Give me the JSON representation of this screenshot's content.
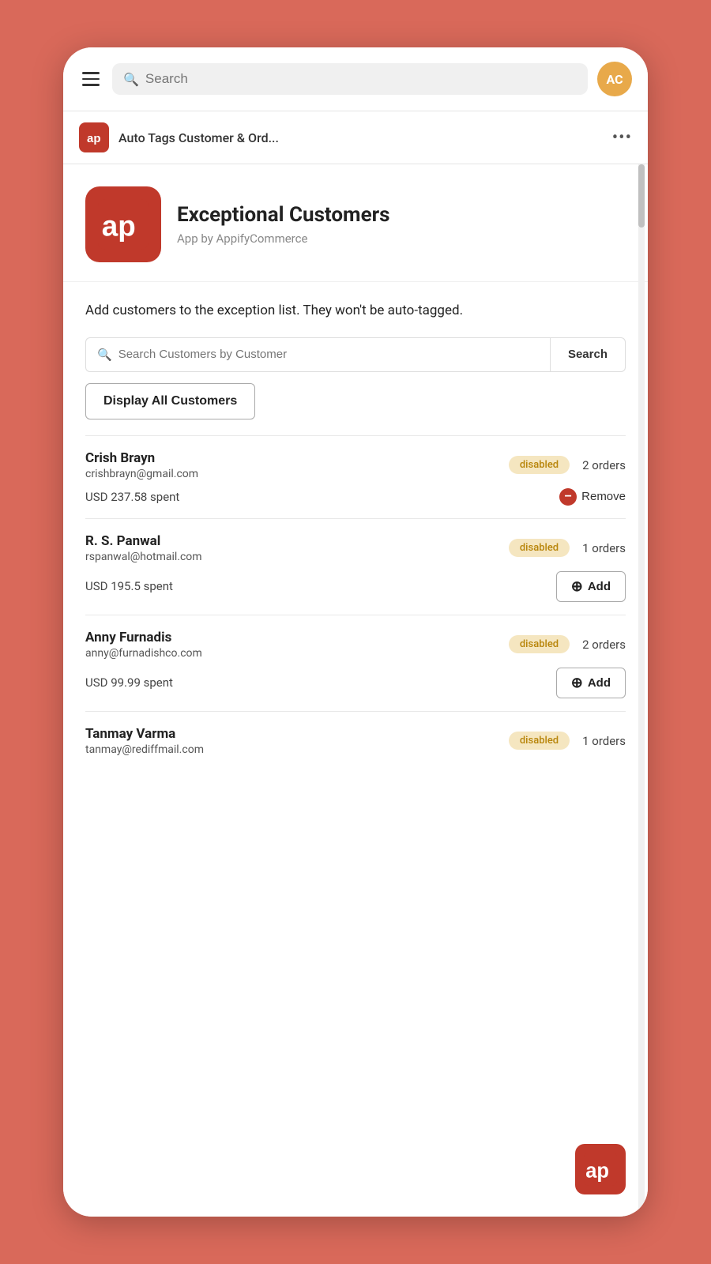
{
  "topbar": {
    "search_placeholder": "Search",
    "avatar_initials": "AC"
  },
  "app_header": {
    "title": "Auto Tags Customer & Ord...",
    "more_label": "•••"
  },
  "branding": {
    "title": "Exceptional Customers",
    "subtitle": "App by AppifyCommerce"
  },
  "description": {
    "text": "Add customers to the exception list. They won't be auto-tagged."
  },
  "search": {
    "input_placeholder": "Search Customers by Customer",
    "button_label": "Search",
    "display_all_label": "Display All Customers"
  },
  "customers": [
    {
      "name": "Crish Brayn",
      "email": "crishbrayn@gmail.com",
      "badge": "disabled",
      "orders": "2 orders",
      "spent": "USD 237.58 spent",
      "action": "remove",
      "action_label": "Remove"
    },
    {
      "name": "R. S. Panwal",
      "email": "rspanwal@hotmail.com",
      "badge": "disabled",
      "orders": "1 orders",
      "spent": "USD 195.5 spent",
      "action": "add",
      "action_label": "Add"
    },
    {
      "name": "Anny Furnadis",
      "email": "anny@furnadishco.com",
      "badge": "disabled",
      "orders": "2 orders",
      "spent": "USD 99.99 spent",
      "action": "add",
      "action_label": "Add"
    },
    {
      "name": "Tanmay Varma",
      "email": "tanmay@rediffmail.com",
      "badge": "disabled",
      "orders": "1 orders",
      "spent": "",
      "action": "none",
      "action_label": ""
    }
  ]
}
